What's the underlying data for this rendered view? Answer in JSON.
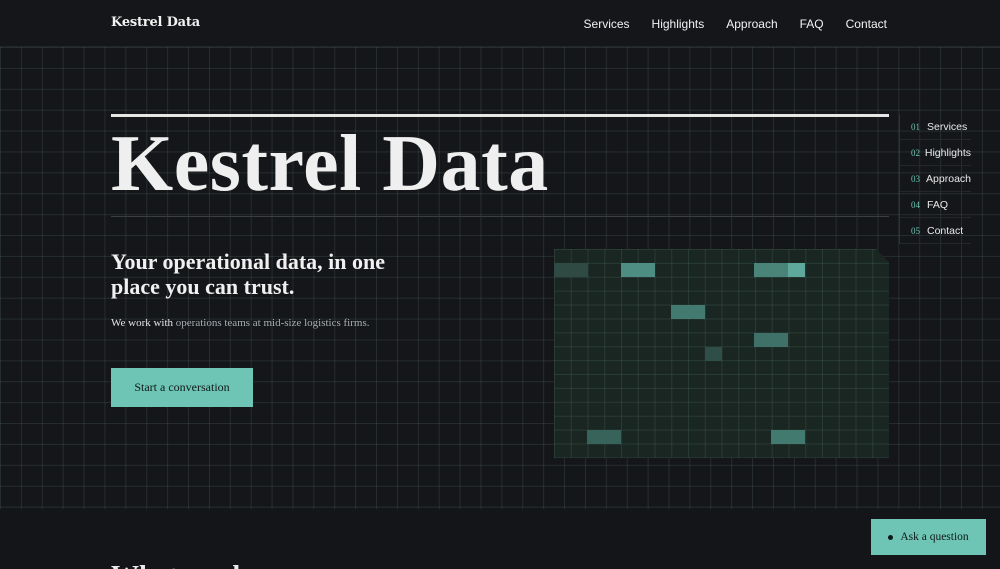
{
  "header": {
    "brand": "Kestrel Data",
    "nav": [
      "Services",
      "Highlights",
      "Approach",
      "FAQ",
      "Contact"
    ]
  },
  "hero": {
    "title": "Kestrel Data",
    "subtitle": "Your operational data, in one place you can trust.",
    "description_lead": "We work with",
    "description_rest": " operations teams at mid-size logistics firms.",
    "cta": "Start a conversation"
  },
  "side_nav": [
    {
      "num": "01",
      "label": "Services"
    },
    {
      "num": "02",
      "label": "Highlights"
    },
    {
      "num": "03",
      "label": "Approach"
    },
    {
      "num": "04",
      "label": "FAQ"
    },
    {
      "num": "05",
      "label": "Contact"
    }
  ],
  "next_section": {
    "title": "What we do"
  },
  "ask_button": "Ask a question",
  "colors": {
    "accent": "#6ec5b5",
    "background": "#131518",
    "visual_bg": "#1a2622"
  }
}
